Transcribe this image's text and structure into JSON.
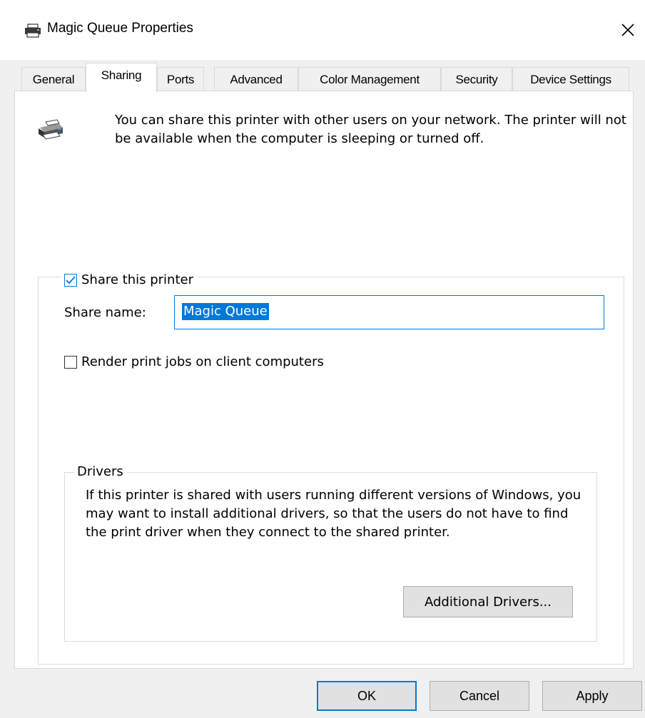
{
  "window": {
    "title": "Magic Queue Properties",
    "close_glyph": "✕"
  },
  "tabs": [
    {
      "label": "General",
      "selected": false
    },
    {
      "label": "Sharing",
      "selected": true
    },
    {
      "label": "Ports",
      "selected": false
    },
    {
      "label": "Advanced",
      "selected": false
    },
    {
      "label": "Color Management",
      "selected": false
    },
    {
      "label": "Security",
      "selected": false
    },
    {
      "label": "Device Settings",
      "selected": false
    }
  ],
  "sharing": {
    "intro_text": "You can share this printer with other users on your network. The printer will not be available when the computer is sleeping or turned off.",
    "share_checkbox_label": "Share this printer",
    "share_checked": true,
    "share_name_label": "Share name:",
    "share_name_value": "Magic Queue",
    "render_checkbox_label": "Render print jobs on client computers",
    "render_checked": false
  },
  "drivers": {
    "legend": "Drivers",
    "text": "If this printer is shared with users running different versions of Windows, you may want to install additional drivers, so that the users do not have to find the print driver when they connect to the shared printer.",
    "additional_button": "Additional Drivers..."
  },
  "buttons": {
    "ok": "OK",
    "cancel": "Cancel",
    "apply": "Apply"
  },
  "colors": {
    "accent": "#0078d7",
    "window_bg": "#f0f0f0",
    "panel_bg": "#ffffff"
  },
  "icons": {
    "title": "printer-icon",
    "close": "close-icon",
    "intro": "printer-icon",
    "checkbox_checked": "checkmark-icon"
  }
}
